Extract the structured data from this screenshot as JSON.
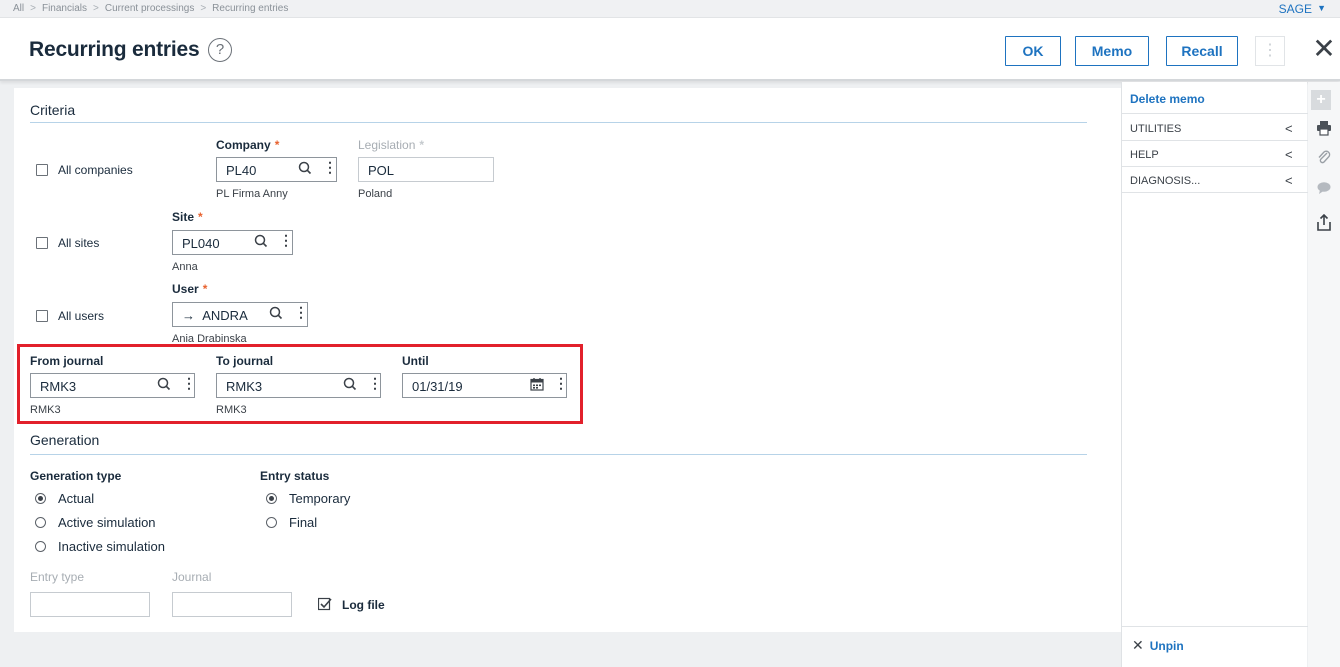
{
  "breadcrumb": [
    "All",
    "Financials",
    "Current processings",
    "Recurring entries"
  ],
  "breadcrumb_separator": ">",
  "user_menu": {
    "label": "SAGE",
    "caret": "▼"
  },
  "header": {
    "title": "Recurring entries",
    "help_glyph": "?",
    "ok_label": "OK",
    "memo_label": "Memo",
    "recall_label": "Recall",
    "more_glyph": "⋮",
    "close_glyph": "✕"
  },
  "criteria": {
    "title": "Criteria",
    "all_companies_label": "All companies",
    "company_label": "Company",
    "company_value": "PL40",
    "company_desc": "PL Firma Anny",
    "legislation_label": "Legislation",
    "legislation_value": "POL",
    "legislation_desc": "Poland",
    "all_sites_label": "All sites",
    "site_label": "Site",
    "site_value": "PL040",
    "site_desc": "Anna",
    "all_users_label": "All users",
    "user_label": "User",
    "user_value": "ANDRA",
    "user_arrow": "→",
    "user_desc": "Ania Drabinska",
    "from_journal_label": "From journal",
    "from_journal_value": "RMK3",
    "from_journal_desc": "RMK3",
    "to_journal_label": "To journal",
    "to_journal_value": "RMK3",
    "to_journal_desc": "RMK3",
    "until_label": "Until",
    "until_value": "01/31/19",
    "required_mark": "*"
  },
  "generation": {
    "title": "Generation",
    "generation_type_label": "Generation type",
    "generation_types": [
      {
        "label": "Actual",
        "selected": true
      },
      {
        "label": "Active simulation",
        "selected": false
      },
      {
        "label": "Inactive simulation",
        "selected": false
      }
    ],
    "entry_status_label": "Entry status",
    "entry_statuses": [
      {
        "label": "Temporary",
        "selected": true
      },
      {
        "label": "Final",
        "selected": false
      }
    ],
    "entry_type_label": "Entry type",
    "entry_type_value": "",
    "journal_label": "Journal",
    "journal_value": "",
    "log_file_label": "Log file",
    "log_file_checked": true
  },
  "right_panel": {
    "delete_memo": "Delete memo",
    "items": [
      {
        "label": "UTILITIES"
      },
      {
        "label": "HELP"
      },
      {
        "label": "DIAGNOSIS..."
      }
    ],
    "chevron": "<",
    "unpin_label": "Unpin"
  },
  "icons": {
    "search": "search-icon",
    "calendar": "calendar-icon",
    "kebab": "kebab-icon",
    "plus": "plus-icon",
    "print": "print-icon",
    "attach": "paperclip-icon",
    "comment": "comment-icon",
    "share": "export-icon",
    "pin": "pin-icon"
  },
  "colors": {
    "accent": "#1e73c0",
    "required": "#e8622f",
    "highlight": "#e2202b",
    "section_line": "#b7d3e8"
  }
}
